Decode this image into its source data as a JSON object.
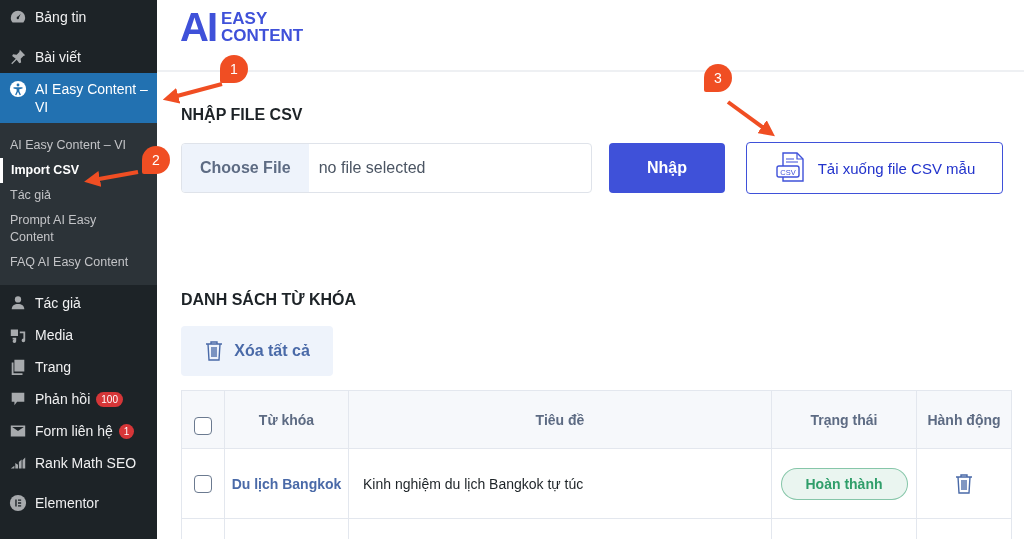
{
  "sidebar": {
    "items": [
      {
        "label": "Bảng tin",
        "kind": "dashboard",
        "selected": false
      },
      {
        "label": "Bài viết",
        "kind": "pin",
        "selected": false
      },
      {
        "label": "AI Easy Content – VI",
        "kind": "accessibility",
        "selected": true,
        "children": [
          {
            "label": "AI Easy Content – VI",
            "selected": false
          },
          {
            "label": "Import CSV",
            "selected": true
          },
          {
            "label": "Tác giả",
            "selected": false
          },
          {
            "label": "Prompt AI Easy Content",
            "selected": false
          },
          {
            "label": "FAQ AI Easy Content",
            "selected": false
          }
        ]
      },
      {
        "label": "Tác giả",
        "kind": "user",
        "selected": false
      },
      {
        "label": "Media",
        "kind": "media",
        "selected": false
      },
      {
        "label": "Trang",
        "kind": "pages",
        "selected": false
      },
      {
        "label": "Phản hồi",
        "kind": "comment",
        "selected": false,
        "badge": "100"
      },
      {
        "label": "Form liên hệ",
        "kind": "mail",
        "selected": false,
        "badge": "1"
      },
      {
        "label": "Rank Math SEO",
        "kind": "chart",
        "selected": false
      },
      {
        "label": "Elementor",
        "kind": "elementor",
        "selected": false
      }
    ]
  },
  "logo": {
    "mark": "AI",
    "lines": [
      "EASY",
      "CONTENT"
    ]
  },
  "import": {
    "heading": "NHẬP FILE CSV",
    "choose_button": "Choose File",
    "file_status": "no file selected",
    "submit_button": "Nhập",
    "download_button": "Tải xuống file CSV mẫu",
    "download_icon_text": "CSV"
  },
  "keywords": {
    "heading": "DANH SÁCH TỪ KHÓA",
    "delete_all_button": "Xóa tất cả",
    "columns": [
      "Từ khóa",
      "Tiêu đề",
      "Trạng thái",
      "Hành động"
    ],
    "select_all_checked": false,
    "rows": [
      {
        "checked": false,
        "keyword": "Du lịch Bangkok",
        "title": "Kinh nghiệm du lịch Bangkok tự túc",
        "status": "Hoàn thành",
        "color": "#2f9e6a"
      }
    ]
  },
  "annotations": [
    {
      "label": "1"
    },
    {
      "label": "2"
    },
    {
      "label": "3"
    }
  ]
}
